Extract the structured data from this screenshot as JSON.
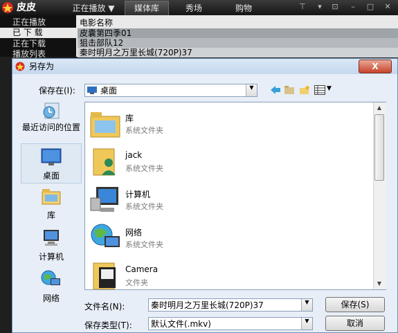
{
  "player": {
    "app_name": "皮皮",
    "tabs": [
      "正在播放",
      "媒体库",
      "秀场",
      "购物"
    ],
    "sidebar": [
      "正在播放",
      "已 下 载",
      "正在下载",
      "播放列表"
    ],
    "movie_header": "电影名称",
    "movies": [
      "皮囊第四季01",
      "狙击部队12",
      "秦时明月之万里长城(720P)37"
    ]
  },
  "dialog": {
    "title": "另存为",
    "close_label": "X",
    "save_in_label": "保存在(I):",
    "save_in_value": "桌面",
    "places": [
      {
        "label": "最近访问的位置",
        "icon": "recent-places-icon"
      },
      {
        "label": "桌面",
        "icon": "desktop-icon"
      },
      {
        "label": "库",
        "icon": "library-icon"
      },
      {
        "label": "计算机",
        "icon": "computer-icon"
      },
      {
        "label": "网络",
        "icon": "network-icon"
      }
    ],
    "files": [
      {
        "name": "库",
        "type": "系统文件夹",
        "icon": "library-folder-icon"
      },
      {
        "name": "jack",
        "type": "系统文件夹",
        "icon": "user-folder-icon"
      },
      {
        "name": "计算机",
        "type": "系统文件夹",
        "icon": "computer-icon"
      },
      {
        "name": "网络",
        "type": "系统文件夹",
        "icon": "network-icon"
      },
      {
        "name": "Camera",
        "type": "文件夹",
        "icon": "folder-icon"
      }
    ],
    "filename_label": "文件名(N):",
    "filename_value": "秦时明月之万里长城(720P)37",
    "filetype_label": "保存类型(T):",
    "filetype_value": "默认文件(.mkv)",
    "save_button": "保存(S)",
    "cancel_button": "取消"
  }
}
